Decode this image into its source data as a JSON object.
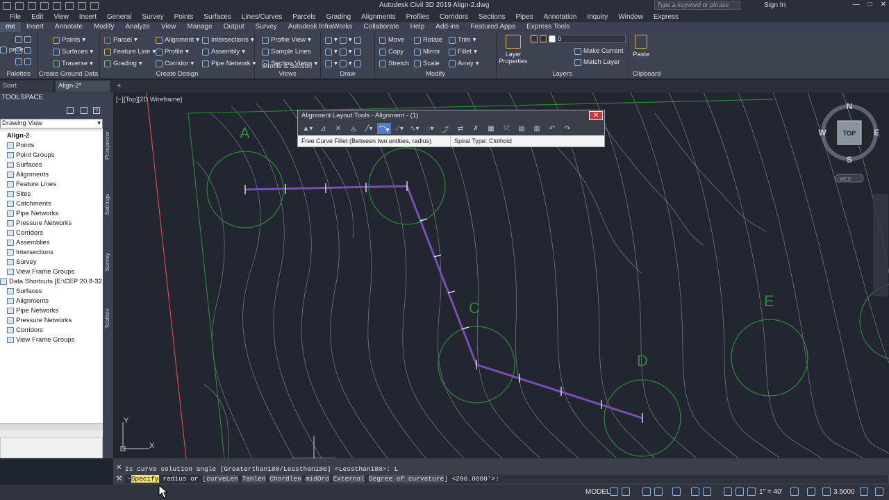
{
  "titlebar": {
    "title": "Autodesk Civil 3D 2019    Align-2.dwg",
    "search_placeholder": "Type a keyword or phrase",
    "signin": "Sign In",
    "win_buttons": [
      "—",
      "□",
      "✕"
    ]
  },
  "menubar": [
    "File",
    "Edit",
    "View",
    "Insert",
    "General",
    "Survey",
    "Points",
    "Surfaces",
    "Lines/Curves",
    "Parcels",
    "Grading",
    "Alignments",
    "Profiles",
    "Corridors",
    "Sections",
    "Pipes",
    "Annotation",
    "Inquiry",
    "Window",
    "Express"
  ],
  "ribbon_tabs": [
    "me",
    "Insert",
    "Annotate",
    "Modify",
    "Analyze",
    "View",
    "Manage",
    "Output",
    "Survey",
    "Autodesk InfraWorks",
    "Collaborate",
    "Help",
    "Add-ins",
    "Featured Apps",
    "Express Tools"
  ],
  "ribbon": {
    "palettes": {
      "label": "pace",
      "title": "Palettes"
    },
    "ground": {
      "items": [
        "Points",
        "Surfaces",
        "Traverse"
      ],
      "title": "Create Ground Data"
    },
    "design": {
      "items": [
        "Parcel",
        "Feature Line",
        "Grading",
        "Alignment",
        "Profile",
        "Corridor",
        "Intersections",
        "Assembly",
        "Pipe Network"
      ],
      "title": "Create Design"
    },
    "profsec": {
      "items": [
        "Profile View",
        "Sample Lines",
        "Section Views"
      ],
      "title": "Profile & Section Views"
    },
    "draw": {
      "title": "Draw"
    },
    "modify": {
      "items": [
        "Move",
        "Copy",
        "Stretch",
        "Rotate",
        "Mirror",
        "Scale",
        "Trim",
        "Fillet",
        "Array"
      ],
      "title": "Modify"
    },
    "layers": {
      "layer_props": "Layer Properties",
      "layer_value": "0",
      "make_current": "Make Current",
      "match_layer": "Match Layer",
      "title": "Layers"
    },
    "clipboard": {
      "paste": "Paste",
      "title": "Clipboard"
    }
  },
  "doc_tabs": [
    {
      "label": "Start"
    },
    {
      "label": "Align-2*"
    }
  ],
  "toolspace": {
    "header": "TOOLSPACE",
    "view": "Drawing View",
    "tree": [
      "Align-2",
      "Points",
      "Point Groups",
      "Surfaces",
      "Alignments",
      "Feature Lines",
      "Sites",
      "Catchments",
      "Pipe Networks",
      "Pressure Networks",
      "Corridors",
      "Assemblies",
      "Intersections",
      "Survey",
      "View Frame Groups",
      "Data Shortcuts [E:\\CEP 20.8-32.4\\De...",
      "Surfaces",
      "Alignments",
      "Pipe Networks",
      "Pressure Networks",
      "Corridors",
      "View Frame Groups"
    ],
    "vtabs": [
      "Prospector",
      "Settings",
      "Survey",
      "Toolbox"
    ]
  },
  "viewport": {
    "label": "[−][Top][2D Wireframe]",
    "compass": {
      "n": "N",
      "s": "S",
      "e": "E",
      "w": "W",
      "top": "TOP",
      "wcs": "WCS"
    },
    "regions": [
      "A",
      "C",
      "D",
      "E"
    ],
    "ucs": {
      "x": "X",
      "y": "Y"
    }
  },
  "alignment_tools": {
    "title": "Alignment Layout Tools - Alignment - (1)",
    "close": "✕",
    "status_left": "Free Curve Fillet (Between two entities, radius)",
    "status_right": "Spiral Type: Clothoid"
  },
  "command": {
    "history": "Is curve solution angle [Greaterthan180/Lessthan180] <Lessthan180>: L",
    "prompt_dash": "-",
    "prompt_hl": "Spec",
    "prompt_after_hl": "ify",
    "prompt_text": " radius or [",
    "opts": [
      "curveLen",
      "Tanlen",
      "Chordlen",
      "midOrd",
      "External",
      "Degree of curvature"
    ],
    "prompt_end": "] <200.0000'>:"
  },
  "statusbar": {
    "model": "MODEL",
    "scale": "1\" = 40'",
    "value": "3.5000"
  }
}
